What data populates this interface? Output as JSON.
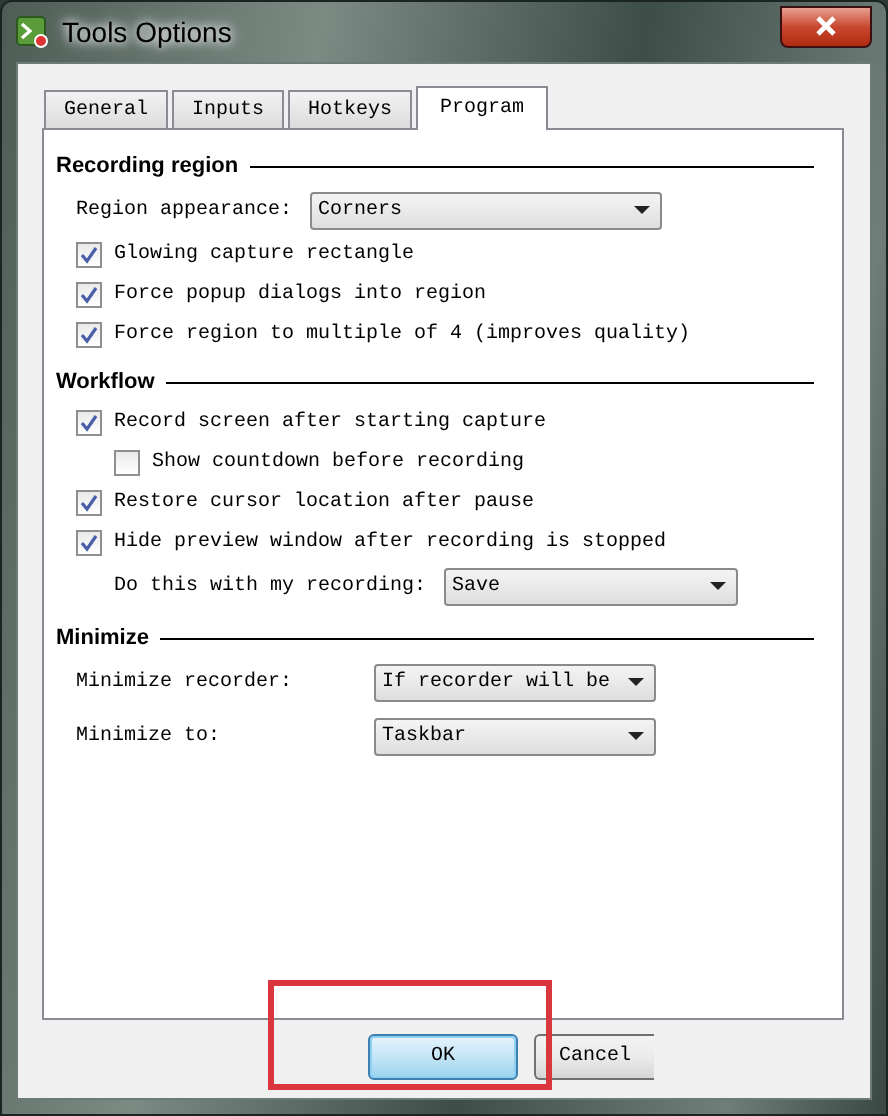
{
  "window": {
    "title": "Tools Options"
  },
  "tabs": [
    {
      "label": "General",
      "selected": false
    },
    {
      "label": "Inputs",
      "selected": false
    },
    {
      "label": "Hotkeys",
      "selected": false
    },
    {
      "label": "Program",
      "selected": true
    }
  ],
  "sections": [
    {
      "title": "Recording region",
      "rows": [
        {
          "kind": "dropdown",
          "label": "Region appearance:",
          "value": "Corners"
        },
        {
          "kind": "checkbox",
          "label": "Glowing capture rectangle",
          "checked": true
        },
        {
          "kind": "checkbox",
          "label": "Force popup dialogs into region",
          "checked": true
        },
        {
          "kind": "checkbox",
          "label": "Force region to multiple of 4 (improves quality)",
          "checked": true
        }
      ]
    },
    {
      "title": "Workflow",
      "rows": [
        {
          "kind": "checkbox",
          "label": "Record screen after starting capture",
          "checked": true,
          "children": [
            {
              "kind": "checkbox",
              "label": "Show countdown before recording",
              "checked": false
            }
          ]
        },
        {
          "kind": "checkbox",
          "label": "Restore cursor location after pause",
          "checked": true
        },
        {
          "kind": "checkbox",
          "label": "Hide preview window after recording is stopped",
          "checked": true,
          "children": [
            {
              "kind": "dropdown",
              "label": "Do this with my recording:",
              "value": "Save"
            }
          ]
        }
      ]
    },
    {
      "title": "Minimize",
      "rows": [
        {
          "kind": "dropdown",
          "label": "Minimize recorder:",
          "value": "If recorder will be"
        },
        {
          "kind": "dropdown",
          "label": "Minimize to:",
          "value": "Taskbar"
        }
      ]
    }
  ],
  "buttons": [
    {
      "label": "OK",
      "default": true
    },
    {
      "label": "Cancel",
      "default": false
    }
  ]
}
